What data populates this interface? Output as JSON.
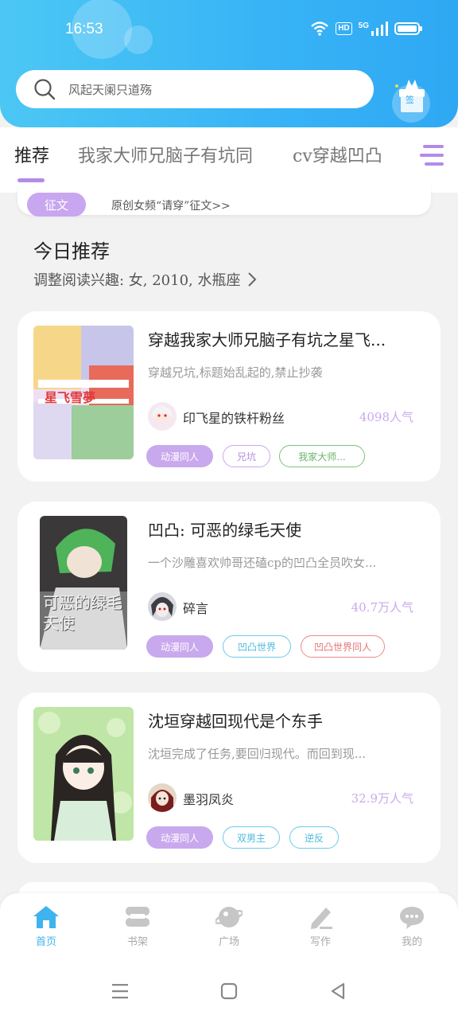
{
  "status_bar": {
    "time": "16:53",
    "hd": "HD",
    "signal": "5G"
  },
  "search": {
    "placeholder": "风起天阑只道殇"
  },
  "checkin": {
    "label": "签"
  },
  "tabs": [
    {
      "label": "推荐",
      "active": true
    },
    {
      "label": "我家大师兄脑子有坑同"
    },
    {
      "label": "cv穿越凹凸"
    }
  ],
  "notice": {
    "badge": "征文",
    "text": "原创女频“请穿”征文>>"
  },
  "section": {
    "title": "今日推荐",
    "subtitle": "调整阅读兴趣: 女, 2010, 水瓶座"
  },
  "books": [
    {
      "title": "穿越我家大师兄脑子有坑之星飞...",
      "desc": "穿越兄坑,标题始乱起的,禁止抄袭",
      "author": "印飞星的铁杆粉丝",
      "popularity": "4098人气",
      "cover_text": "星飞雪夢",
      "tags": [
        {
          "label": "动漫同人",
          "style": "filled"
        },
        {
          "label": "兄坑",
          "style": "purple"
        },
        {
          "label": "我家大师...",
          "style": "green"
        }
      ]
    },
    {
      "title": "凹凸: 可恶的绿毛天使",
      "desc": "一个沙雕喜欢帅哥还磕cp的凹凸全员吹女...",
      "author": "碎言",
      "popularity": "40.7万人气",
      "cover_text": "可恶的绿毛天使",
      "tags": [
        {
          "label": "动漫同人",
          "style": "filled"
        },
        {
          "label": "凹凸世界",
          "style": "blue"
        },
        {
          "label": "凹凸世界同人",
          "style": "red"
        }
      ]
    },
    {
      "title": "沈垣穿越回现代是个东手",
      "desc": "沈垣完成了任务,要回归现代。而回到现...",
      "author": "墨羽凤炎",
      "popularity": "32.9万人气",
      "cover_text": "",
      "tags": [
        {
          "label": "动漫同人",
          "style": "filled"
        },
        {
          "label": "双男主",
          "style": "blue"
        },
        {
          "label": "逆反",
          "style": "blue"
        }
      ]
    }
  ],
  "bottom_nav": [
    {
      "label": "首页",
      "icon": "home-icon",
      "active": true
    },
    {
      "label": "书架",
      "icon": "bookshelf-icon"
    },
    {
      "label": "广场",
      "icon": "plaza-icon"
    },
    {
      "label": "写作",
      "icon": "write-icon"
    },
    {
      "label": "我的",
      "icon": "profile-icon"
    }
  ],
  "colors": {
    "header": "#37b3f6",
    "accent_purple": "#c9a9ee",
    "active_blue": "#3fb3ee"
  }
}
